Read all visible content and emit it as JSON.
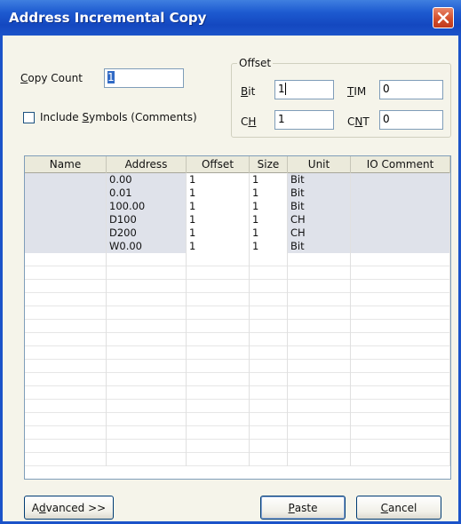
{
  "window": {
    "title": "Address Incremental Copy",
    "close_icon": "close-icon"
  },
  "copy_count": {
    "label_pre": "",
    "label_mnemonic": "C",
    "label_post": "opy Count",
    "value": "1"
  },
  "include_symbols": {
    "label_pre": "Include ",
    "label_mnemonic": "S",
    "label_post": "ymbols (Comments)",
    "checked": false
  },
  "offset_group": {
    "legend": "Offset",
    "bit": {
      "label_mnemonic": "B",
      "label_post": "it",
      "value": "1"
    },
    "ch": {
      "label_pre": "C",
      "label_mnemonic": "H",
      "value": "1"
    },
    "tim": {
      "label_mnemonic": "T",
      "label_post": "IM",
      "value": "0"
    },
    "cnt": {
      "label_pre": "C",
      "label_mnemonic": "N",
      "label_post": "T",
      "value": "0"
    }
  },
  "table": {
    "columns": [
      "Name",
      "Address",
      "Offset",
      "Size",
      "Unit",
      "IO Comment"
    ],
    "rows": [
      {
        "name": "",
        "address": "0.00",
        "offset": "1",
        "size": "1",
        "unit": "Bit",
        "io_comment": ""
      },
      {
        "name": "",
        "address": "0.01",
        "offset": "1",
        "size": "1",
        "unit": "Bit",
        "io_comment": ""
      },
      {
        "name": "",
        "address": "100.00",
        "offset": "1",
        "size": "1",
        "unit": "Bit",
        "io_comment": ""
      },
      {
        "name": "",
        "address": "D100",
        "offset": "1",
        "size": "1",
        "unit": "CH",
        "io_comment": ""
      },
      {
        "name": "",
        "address": "D200",
        "offset": "1",
        "size": "1",
        "unit": "CH",
        "io_comment": ""
      },
      {
        "name": "",
        "address": "W0.00",
        "offset": "1",
        "size": "1",
        "unit": "Bit",
        "io_comment": ""
      }
    ]
  },
  "buttons": {
    "advanced": {
      "pre": "A",
      "mnemonic": "d",
      "post": "vanced >>"
    },
    "paste": {
      "pre": "",
      "mnemonic": "P",
      "post": "aste"
    },
    "cancel": {
      "pre": "",
      "mnemonic": "C",
      "post": "ancel"
    }
  }
}
